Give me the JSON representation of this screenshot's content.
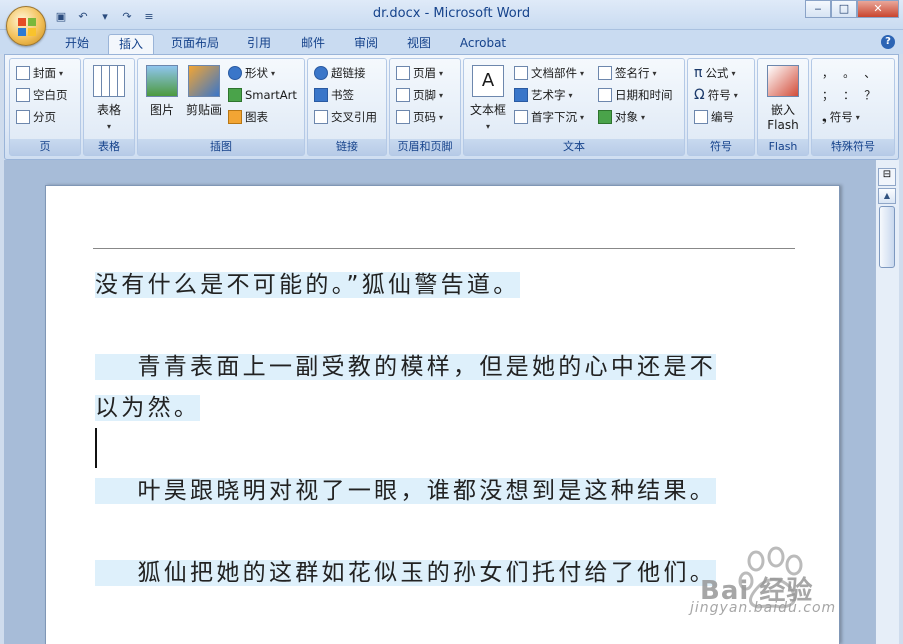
{
  "window": {
    "title": "dr.docx - Microsoft Word",
    "minimize": "‒",
    "maximize": "□",
    "close": "✕"
  },
  "tabs": [
    "开始",
    "插入",
    "页面布局",
    "引用",
    "邮件",
    "审阅",
    "视图",
    "Acrobat"
  ],
  "active_tab": "插入",
  "ribbon": {
    "page": {
      "label": "页",
      "cover": "封面",
      "blank": "空白页",
      "break": "分页"
    },
    "table": {
      "label": "表格",
      "table": "表格"
    },
    "illustrations": {
      "label": "插图",
      "picture": "图片",
      "clipart": "剪贴画",
      "shapes": "形状",
      "smartart": "SmartArt",
      "chart": "图表"
    },
    "links": {
      "label": "链接",
      "hyperlink": "超链接",
      "bookmark": "书签",
      "crossref": "交叉引用"
    },
    "header_footer": {
      "label": "页眉和页脚",
      "header": "页眉",
      "footer": "页脚",
      "pagenum": "页码"
    },
    "text": {
      "label": "文本",
      "textbox": "文本框",
      "parts": "文档部件",
      "wordart": "艺术字",
      "dropcap": "首字下沉",
      "signature": "签名行",
      "datetime": "日期和时间",
      "object": "对象"
    },
    "symbols": {
      "label": "符号",
      "equation": "公式",
      "symbol": "符号",
      "number": "编号"
    },
    "flash": {
      "label": "Flash",
      "embed": "嵌入",
      "flash": "Flash"
    },
    "special": {
      "label": "特殊符号",
      "chars_row1": "，  。  、",
      "chars_row2": "；  ：  ？",
      "symbol": "符号"
    }
  },
  "document": {
    "paragraphs": [
      "没有什么是不可能的。”狐仙警告道。",
      "    青青表面上一副受教的模样，但是她的心中还是不",
      "以为然。",
      "    叶昊跟晓明对视了一眼，谁都没想到是这种结果。",
      "    狐仙把她的这群如花似玉的孙女们托付给了他们。"
    ]
  },
  "watermark": {
    "text": "jingyan.baidu.com",
    "brand": "Bai 经验"
  },
  "colors": {
    "title_text": "#15428b",
    "highlight": "#def0fb"
  }
}
